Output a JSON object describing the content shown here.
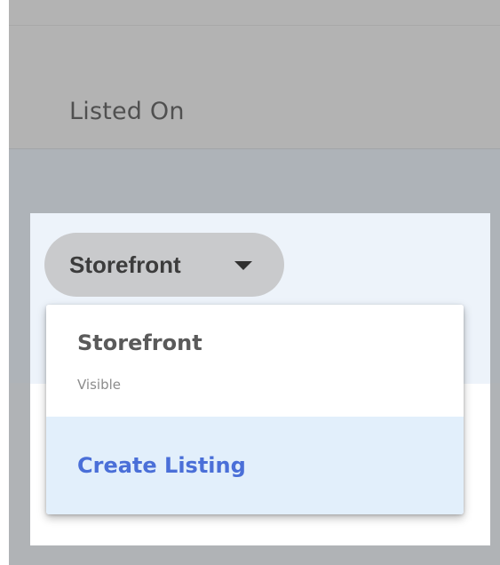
{
  "table": {
    "column_header": "Listed On"
  },
  "channel_select": {
    "selected_label": "Storefront",
    "caret_icon": "caret-down-icon"
  },
  "dropdown_menu": {
    "items": [
      {
        "label": "Storefront",
        "sublabel": "Visible"
      },
      {
        "label": "Create Listing"
      }
    ]
  },
  "colors": {
    "accent_link": "#4a6fd8",
    "menu_highlight": "#e2effb",
    "pill_background": "#c9cacc"
  }
}
